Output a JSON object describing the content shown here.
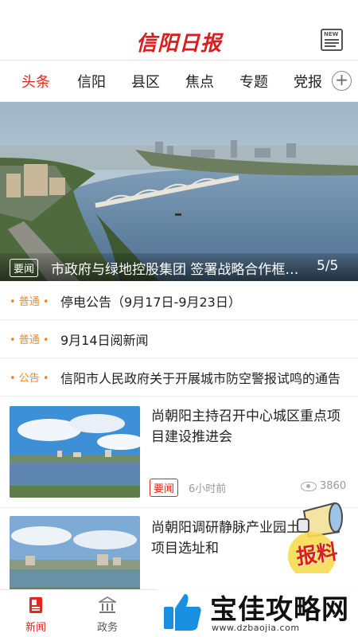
{
  "header": {
    "logo_text": "信阳日报",
    "news_icon_text": "NEW"
  },
  "tabs": [
    {
      "label": "头条",
      "active": true
    },
    {
      "label": "信阳",
      "active": false
    },
    {
      "label": "县区",
      "active": false
    },
    {
      "label": "焦点",
      "active": false
    },
    {
      "label": "专题",
      "active": false
    },
    {
      "label": "党报",
      "active": false
    }
  ],
  "add_tab_glyph": "+",
  "hero": {
    "tag": "要闻",
    "title": "市政府与绿地控股集团 签署战略合作框架协议",
    "counter": "5/5"
  },
  "notices": [
    {
      "tag": "• 普通 •",
      "text": "停电公告（9月17日-9月23日）"
    },
    {
      "tag": "• 普通 •",
      "text": "9月14日阅新闻"
    },
    {
      "tag": "• 公告 •",
      "text": "信阳市人民政府关于开展城市防空警报试鸣的通告"
    }
  ],
  "articles": [
    {
      "title": "尚朝阳主持召开中心城区重点项目建设推进会",
      "tag": "要闻",
      "time": "6小时前",
      "views": "3860"
    },
    {
      "title": "尚朝阳调研静脉产业园土消纳场项目选址和",
      "tag": "",
      "time": "",
      "views": ""
    }
  ],
  "bottom_nav": [
    {
      "label": "新闻",
      "icon": "newspaper-icon",
      "active": true
    },
    {
      "label": "政务",
      "icon": "government-building-icon",
      "active": false
    }
  ],
  "baoliao": {
    "label": "报料"
  },
  "watermark": {
    "title": "宝佳攻略网",
    "url": "www.dzbaojia.com"
  },
  "colors": {
    "accent": "#e0281e",
    "notice_tag": "#f08a24",
    "logo": "#d81e1e"
  }
}
